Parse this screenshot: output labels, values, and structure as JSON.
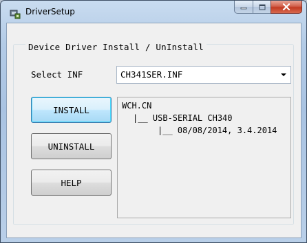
{
  "window": {
    "title": "DriverSetup",
    "icon": "driver-setup-app-icon",
    "caption_buttons": [
      "minimize",
      "maximize",
      "close"
    ]
  },
  "group": {
    "title": "Device Driver Install / UnInstall"
  },
  "inf_select": {
    "label": "Select INF",
    "value": "CH341SER.INF"
  },
  "buttons": {
    "install": "INSTALL",
    "uninstall": "UNINSTALL",
    "help": "HELP"
  },
  "info": {
    "line1": "WCH.CN",
    "line2": "|__ USB-SERIAL CH340",
    "line3": "|__ 08/08/2014, 3.4.2014"
  },
  "colors": {
    "titlebar": "#b3cbe6",
    "client_bg": "#f0f0f0",
    "close_button": "#c23a22",
    "focused_button": "#bee6fd"
  }
}
